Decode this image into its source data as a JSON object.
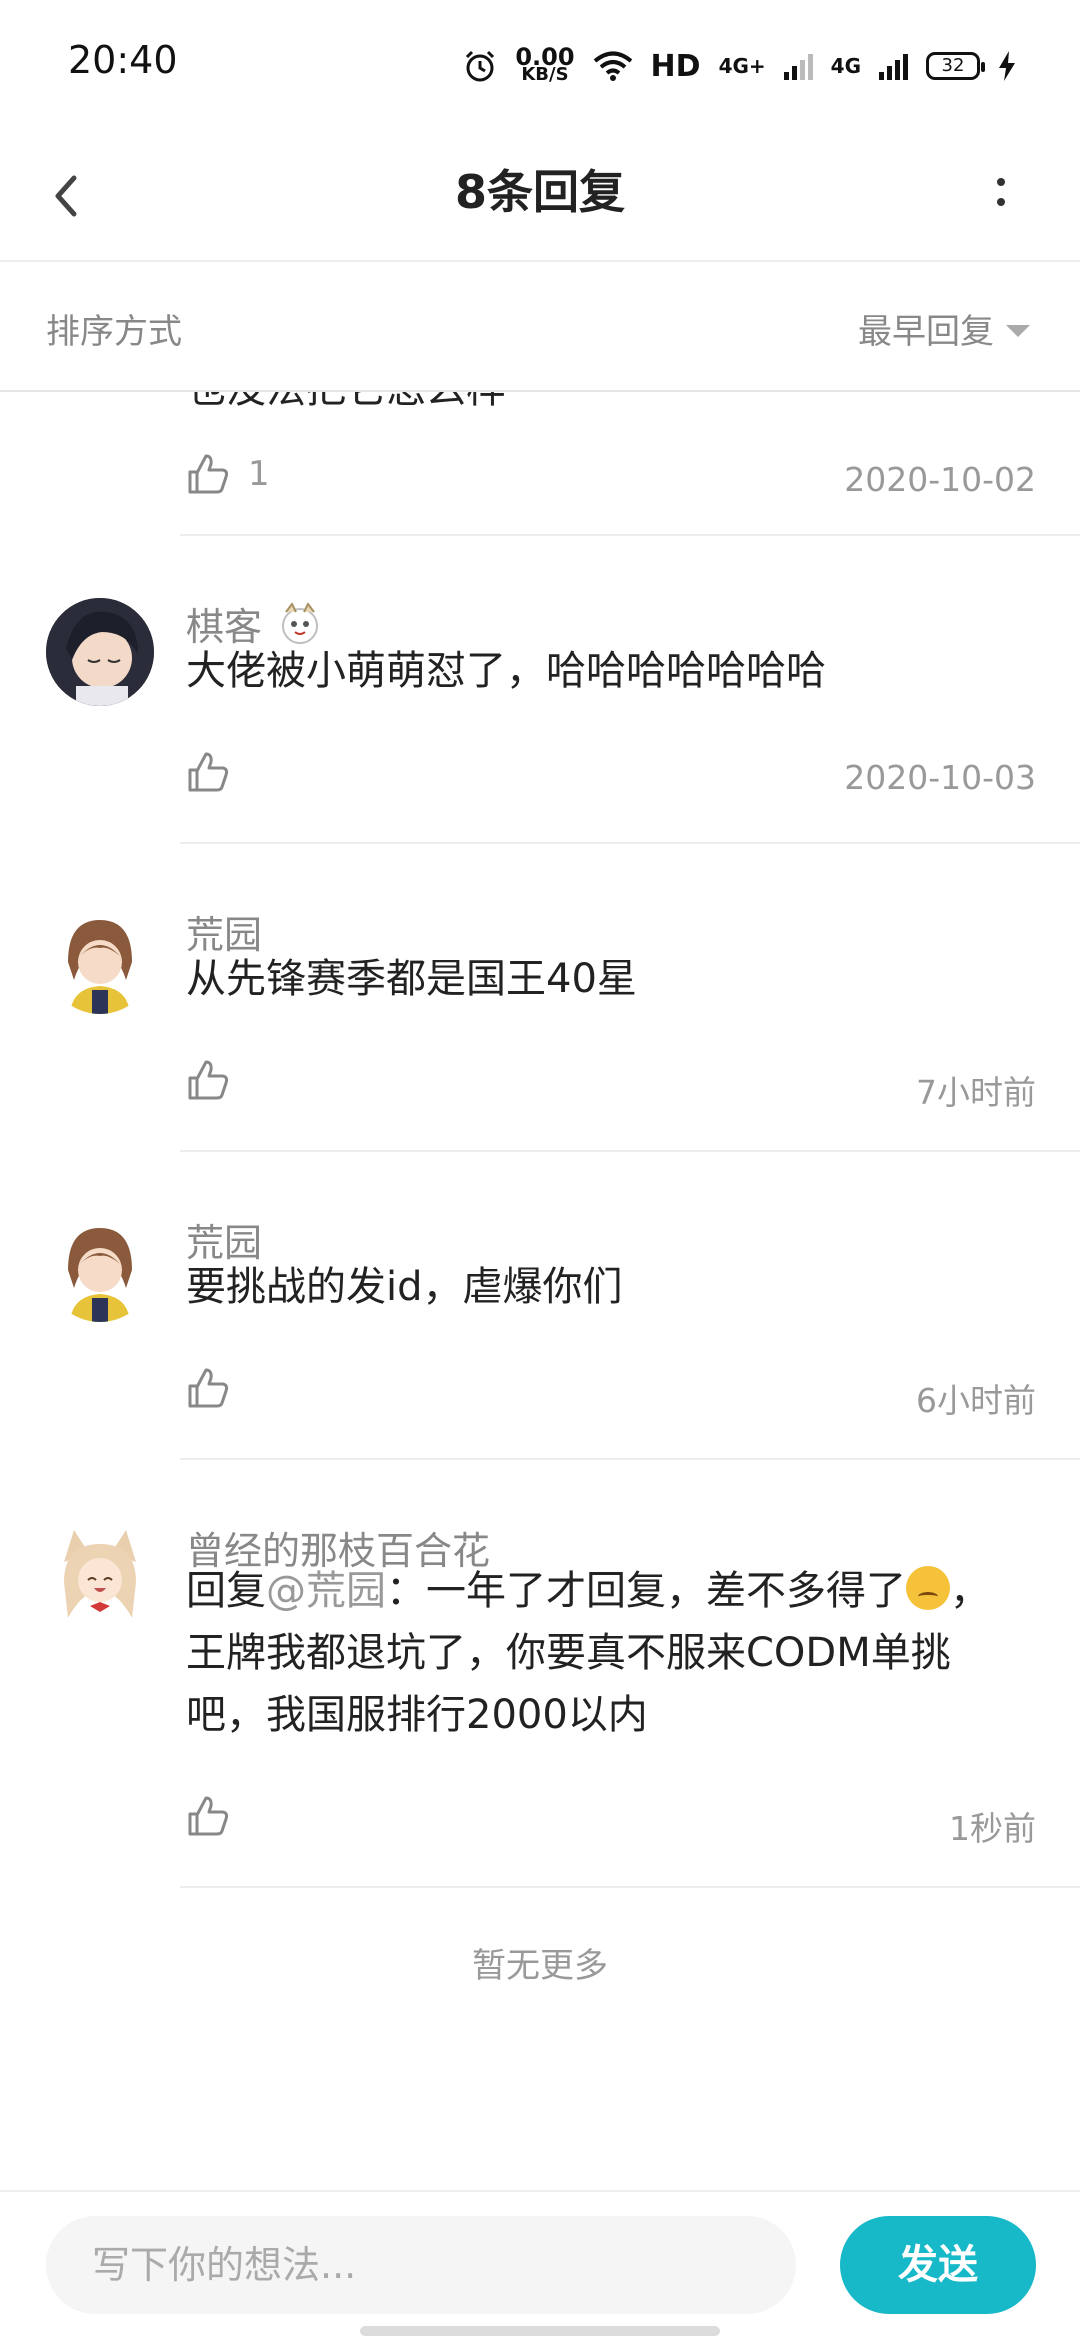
{
  "status_bar": {
    "time": "20:40",
    "net_speed_value": "0.00",
    "net_speed_unit": "KB/S",
    "hd_label": "HD",
    "sim1_label": "4G+",
    "sim2_label": "4G",
    "battery_level": "32",
    "icons": [
      "alarm-icon",
      "wifi-icon",
      "signal-icon",
      "battery-icon",
      "charging-icon"
    ]
  },
  "header": {
    "title": "8条回复"
  },
  "sort": {
    "label": "排序方式",
    "selected": "最早回复"
  },
  "partial_comment": {
    "text": "也没法把它怎么样",
    "likes": "1",
    "date": "2020-10-02"
  },
  "comments": [
    {
      "user": "棋客",
      "text": "大佬被小萌萌怼了，哈哈哈哈哈哈哈",
      "likes": "",
      "date": "2020-10-03"
    },
    {
      "user": "荒园",
      "text": "从先锋赛季都是国王40星",
      "likes": "",
      "date": "7小时前"
    },
    {
      "user": "荒园",
      "text": "要挑战的发id，虐爆你们",
      "likes": "",
      "date": "6小时前"
    },
    {
      "user": "曾经的那枝百合花",
      "reply_prefix": "回复",
      "mention": "@荒园",
      "text_part1": "：一年了才回复，差不多得了",
      "text_part2": "，",
      "text_line2": "王牌我都退坑了，你要真不服来CODM单挑",
      "text_line3": "吧，我国服排行2000以内",
      "likes": "",
      "date": "1秒前"
    }
  ],
  "no_more": "暂无更多",
  "input": {
    "placeholder": "写下你的想法..."
  },
  "send_label": "发送",
  "colors": {
    "accent": "#17b8c8",
    "meta_gray": "#999999",
    "divider": "#ececec"
  }
}
